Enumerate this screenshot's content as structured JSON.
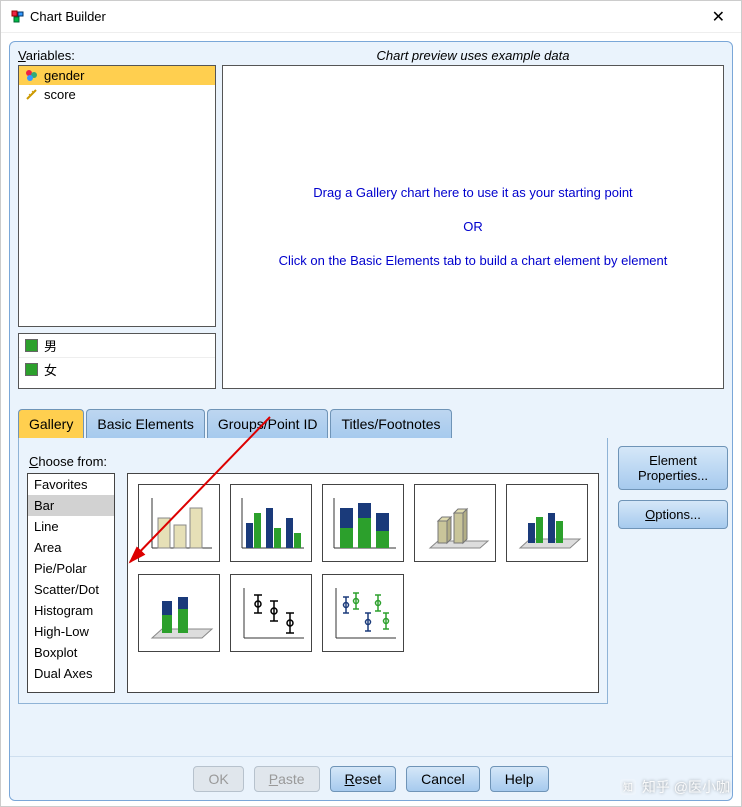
{
  "window": {
    "title": "Chart Builder"
  },
  "variables": {
    "label_prefix": "V",
    "label_rest": "ariables:",
    "items": [
      {
        "name": "gender",
        "type": "nominal",
        "selected": true
      },
      {
        "name": "score",
        "type": "scale",
        "selected": false
      }
    ],
    "categories": [
      "男",
      "女"
    ]
  },
  "preview": {
    "header": "Chart preview uses example data",
    "line1": "Drag a Gallery chart here to use it as your starting point",
    "line2": "OR",
    "line3": "Click on the Basic Elements tab to build a chart element by element"
  },
  "tabs": {
    "items": [
      "Gallery",
      "Basic Elements",
      "Groups/Point ID",
      "Titles/Footnotes"
    ],
    "active_index": 0
  },
  "gallery": {
    "choose_prefix": "C",
    "choose_rest": "hoose from:",
    "types": [
      "Favorites",
      "Bar",
      "Line",
      "Area",
      "Pie/Polar",
      "Scatter/Dot",
      "Histogram",
      "High-Low",
      "Boxplot",
      "Dual Axes"
    ],
    "selected_type_index": 1,
    "thumbnails": [
      "simple-bar",
      "clustered-bar",
      "stacked-bar",
      "3d-bar",
      "3d-clustered-bar",
      "3d-stacked-bar",
      "error-bar-simple",
      "error-bar-clustered"
    ]
  },
  "side_buttons": {
    "element_properties": "Element Properties...",
    "options_prefix": "O",
    "options_rest": "ptions..."
  },
  "bottom": {
    "ok": "OK",
    "paste_prefix": "P",
    "paste_rest": "aste",
    "reset_prefix": "R",
    "reset_rest": "eset",
    "cancel": "Cancel",
    "help": "Help"
  },
  "watermark": "知乎 @医小咖"
}
